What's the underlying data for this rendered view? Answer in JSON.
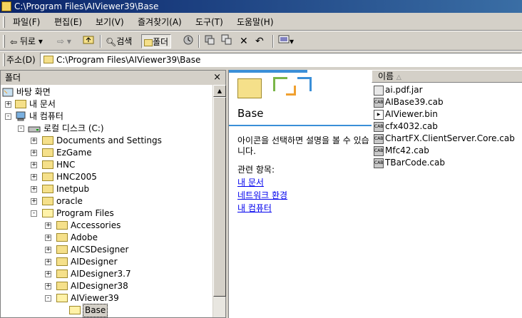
{
  "window": {
    "title": "C:\\Program Files\\AIViewer39\\Base"
  },
  "menu": [
    "파일(F)",
    "편집(E)",
    "보기(V)",
    "즐겨찾기(A)",
    "도구(T)",
    "도움말(H)"
  ],
  "toolbar": {
    "back": "뒤로",
    "search": "검색",
    "folders": "폴더"
  },
  "address": {
    "label": "주소(D)",
    "value": "C:\\Program Files\\AIViewer39\\Base"
  },
  "folders_pane": {
    "title": "폴더",
    "close": "×",
    "tree": [
      {
        "label": "바탕 화면"
      },
      {
        "label": "내 문서",
        "expander": "+"
      },
      {
        "label": "내 컴퓨터",
        "expander": "-"
      },
      {
        "label": "로컬 디스크 (C:)",
        "expander": "-"
      },
      {
        "label": "Documents and Settings",
        "expander": "+"
      },
      {
        "label": "EzGame",
        "expander": "+"
      },
      {
        "label": "HNC",
        "expander": "+"
      },
      {
        "label": "HNC2005",
        "expander": "+"
      },
      {
        "label": "Inetpub",
        "expander": "+"
      },
      {
        "label": "oracle",
        "expander": "+"
      },
      {
        "label": "Program Files",
        "expander": "-"
      },
      {
        "label": "Accessories",
        "expander": "+"
      },
      {
        "label": "Adobe",
        "expander": "+"
      },
      {
        "label": "AICSDesigner",
        "expander": "+"
      },
      {
        "label": "AIDesigner",
        "expander": "+"
      },
      {
        "label": "AIDesigner3.7",
        "expander": "+"
      },
      {
        "label": "AIDesigner38",
        "expander": "+"
      },
      {
        "label": "AIViewer39",
        "expander": "-"
      },
      {
        "label": "Base"
      }
    ]
  },
  "web_view": {
    "title": "Base",
    "description": "아이콘을 선택하면 설명을 볼 수 있습니다.",
    "related_label": "관련 항목:",
    "links": [
      "내 문서",
      "네트워크 환경",
      "내 컴퓨터"
    ]
  },
  "file_list": {
    "column_name": "이름",
    "sort_indicator": "△",
    "files": [
      {
        "name": "ai.pdf.jar",
        "icon": "jar-file-icon"
      },
      {
        "name": "AIBase39.cab",
        "icon": "cab-file-icon"
      },
      {
        "name": "AIViewer.bin",
        "icon": "bin-file-icon"
      },
      {
        "name": "cfx4032.cab",
        "icon": "cab-file-icon"
      },
      {
        "name": "ChartFX.ClientServer.Core.cab",
        "icon": "cab-file-icon"
      },
      {
        "name": "Mfc42.cab",
        "icon": "cab-file-icon"
      },
      {
        "name": "TBarCode.cab",
        "icon": "cab-file-icon"
      }
    ]
  }
}
